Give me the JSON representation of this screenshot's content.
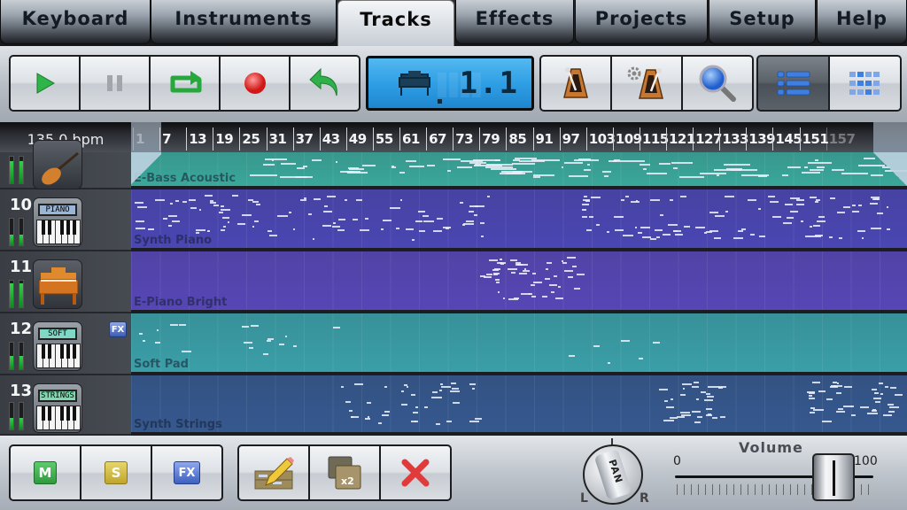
{
  "tabs": [
    {
      "label": "Keyboard",
      "active": false
    },
    {
      "label": "Instruments",
      "active": false
    },
    {
      "label": "Tracks",
      "active": true
    },
    {
      "label": "Effects",
      "active": false
    },
    {
      "label": "Projects",
      "active": false
    },
    {
      "label": "Setup",
      "active": false
    },
    {
      "label": "Help",
      "active": false
    }
  ],
  "transport": {
    "buttons": [
      {
        "name": "play",
        "icon": "play-icon"
      },
      {
        "name": "pause",
        "icon": "pause-icon"
      },
      {
        "name": "loop",
        "icon": "loop-icon"
      },
      {
        "name": "record",
        "icon": "record-icon"
      },
      {
        "name": "undo",
        "icon": "undo-icon"
      }
    ]
  },
  "lcd": {
    "position": "1.1",
    "icon": "piano-icon"
  },
  "tools": {
    "buttons": [
      {
        "name": "metronome",
        "icon": "metronome-icon"
      },
      {
        "name": "metronome-settings",
        "icon": "metronome-gear-icon"
      },
      {
        "name": "zoom",
        "icon": "magnifier-icon"
      }
    ]
  },
  "view_modes": [
    {
      "name": "list-view",
      "icon": "list-icon",
      "active": true
    },
    {
      "name": "grid-view",
      "icon": "grid-icon",
      "active": false
    }
  ],
  "ruler": {
    "bpm": "135.0 bpm",
    "marks": [
      "1",
      "7",
      "13",
      "19",
      "25",
      "31",
      "37",
      "43",
      "49",
      "55",
      "61",
      "67",
      "73",
      "79",
      "85",
      "91",
      "97",
      "103",
      "109",
      "115",
      "121",
      "127",
      "133",
      "139",
      "145",
      "151",
      "157"
    ]
  },
  "tracks": [
    {
      "number": "",
      "name": "E-Bass Acoustic",
      "instrument": "bass-guitar-icon",
      "screen": "",
      "fx": false,
      "color": "#3aa79b",
      "meter": [
        0.85,
        0.85
      ]
    },
    {
      "number": "10",
      "name": "Synth Piano",
      "instrument": "keyboard-icon",
      "screen": "PIANO",
      "screen_color": "#9ab6d6",
      "fx": false,
      "color": "#4a46b3",
      "meter": [
        0.4,
        0.4
      ]
    },
    {
      "number": "11",
      "name": "E-Piano Bright",
      "instrument": "upright-piano-icon",
      "screen": "",
      "fx": false,
      "color": "#5646b6",
      "meter": [
        0.9,
        0.9
      ]
    },
    {
      "number": "12",
      "name": "Soft Pad",
      "instrument": "keyboard-icon",
      "screen": "SOFT",
      "screen_color": "#7fd8c6",
      "fx": true,
      "fx_label": "FX",
      "color": "#3a9fa8",
      "meter": [
        0.5,
        0.5
      ]
    },
    {
      "number": "13",
      "name": "Synth Strings",
      "instrument": "keyboard-icon",
      "screen": "STRINGS",
      "screen_color": "#7fd8b0",
      "fx": false,
      "color": "#35588f",
      "meter": [
        0.45,
        0.45
      ]
    }
  ],
  "bottom": {
    "track_buttons": [
      {
        "name": "mute",
        "label": "M",
        "color": "#3aa64a"
      },
      {
        "name": "solo",
        "label": "S",
        "color": "#c9b338"
      },
      {
        "name": "fx",
        "label": "FX",
        "color": "#4a6cc8"
      }
    ],
    "edit_buttons": [
      {
        "name": "edit",
        "icon": "pencil-edit-icon"
      },
      {
        "name": "duplicate",
        "icon": "duplicate-x2-icon",
        "label": "x2"
      },
      {
        "name": "delete",
        "icon": "delete-x-icon"
      }
    ],
    "pan": {
      "label": "PAN",
      "left": "L",
      "right": "R",
      "value": 0
    },
    "volume": {
      "label": "Volume",
      "min": "0",
      "max": "100",
      "value": 80
    }
  }
}
